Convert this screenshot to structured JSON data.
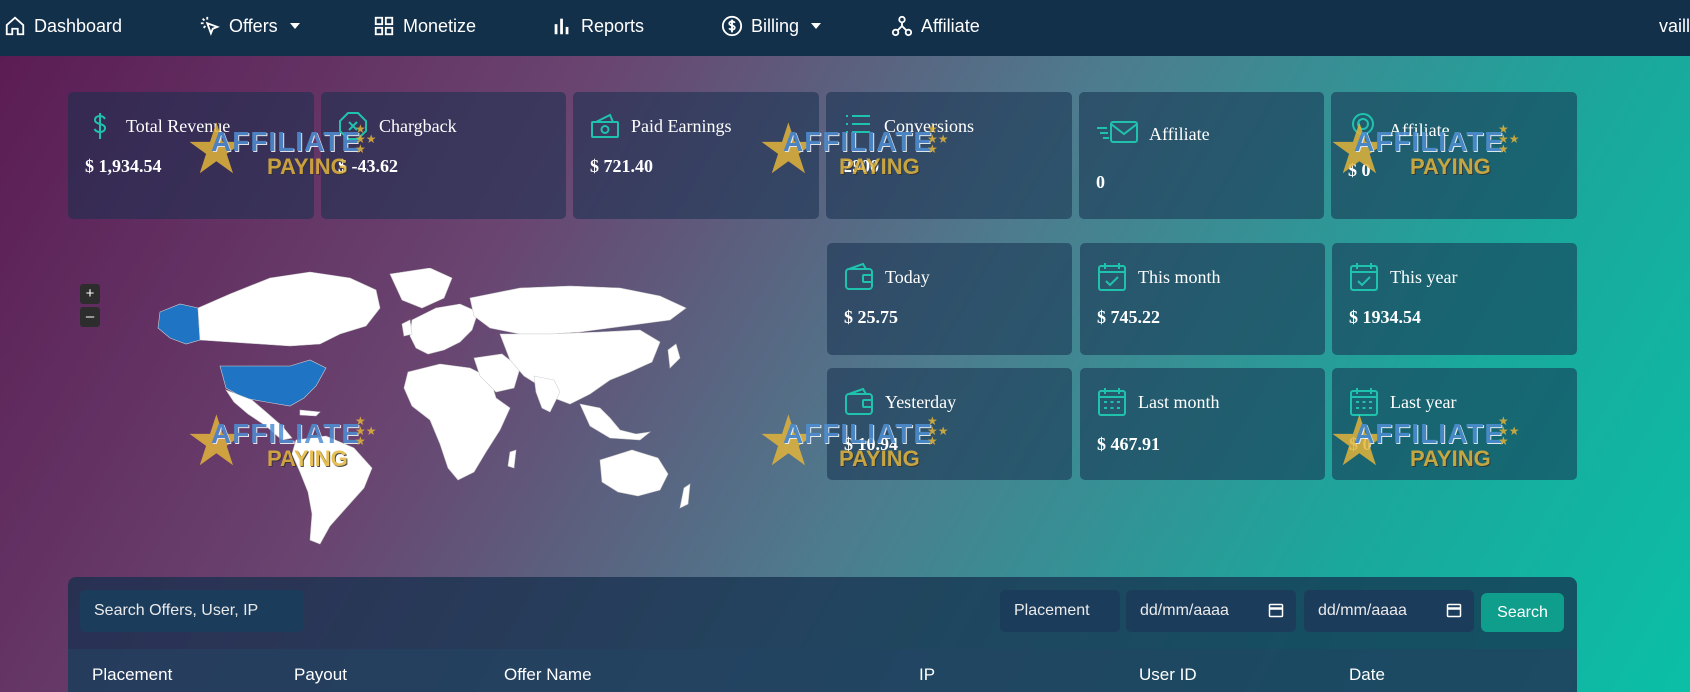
{
  "nav": {
    "dashboard": "Dashboard",
    "offers": "Offers",
    "monetize": "Monetize",
    "reports": "Reports",
    "billing": "Billing",
    "affiliate": "Affiliate",
    "user": "vaill"
  },
  "cards": {
    "total_revenue": {
      "title": "Total Revenue",
      "value": "$ 1,934.54"
    },
    "chargback": {
      "title": "Chargback",
      "value": "$ -43.62"
    },
    "paid_earnings": {
      "title": "Paid Earnings",
      "value": "$ 721.40"
    },
    "conversions": {
      "title": "Conversions",
      "value": "2900"
    },
    "affiliate_count": {
      "title": "Affiliate",
      "value": "0"
    },
    "affiliate_earnings": {
      "title": "Affiliate",
      "value": "$ 0"
    },
    "today": {
      "title": "Today",
      "value": "$ 25.75"
    },
    "this_month": {
      "title": "This month",
      "value": "$ 745.22"
    },
    "this_year": {
      "title": "This year",
      "value": "$ 1934.54"
    },
    "yesterday": {
      "title": "Yesterday",
      "value": "$ 10.94"
    },
    "last_month": {
      "title": "Last month",
      "value": "$ 467.91"
    },
    "last_year": {
      "title": "Last year",
      "value": "$ 0"
    }
  },
  "watermark": {
    "line1": "AFFILIATE",
    "line2": "PAYING"
  },
  "map": {
    "zoom_in": "+",
    "zoom_out": "–",
    "highlighted_country": "United States",
    "highlight_color": "#1f74c4"
  },
  "search": {
    "placeholder": "Search Offers, User, IP",
    "placement": "Placement",
    "date_from": "dd/mm/aaaa",
    "date_to": "dd/mm/aaaa",
    "button": "Search"
  },
  "table": {
    "columns": [
      "Placement",
      "Payout",
      "Offer Name",
      "IP",
      "User ID",
      "Date"
    ]
  },
  "colors": {
    "accent": "#0f9e8c",
    "icon": "#1fc3ad",
    "nav_bg": "#13304a"
  }
}
